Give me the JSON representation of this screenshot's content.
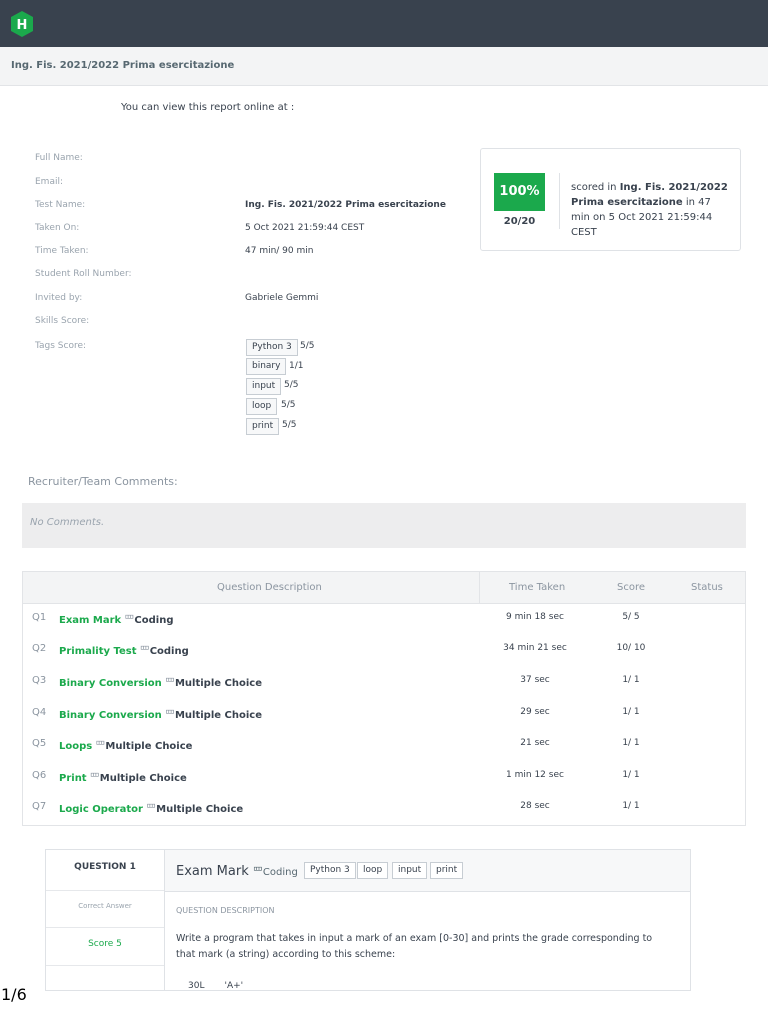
{
  "brand": {
    "logo_letter": "H",
    "logo_color": "#1ba94c",
    "topbar_color": "#39424e"
  },
  "subbar": {
    "title": "Ing. Fis. 2021/2022 Prima esercitazione"
  },
  "online_text": "You can view this report online at :",
  "info": {
    "full_name_label": "Full Name:",
    "email_label": "Email:",
    "test_name_label": "Test Name:",
    "test_name_value": "Ing. Fis. 2021/2022 Prima esercitazione",
    "taken_on_label": "Taken On:",
    "taken_on_value": "5 Oct 2021 21:59:44 CEST",
    "time_taken_label": "Time Taken:",
    "time_taken_value": "47 min/ 90 min",
    "roll_label": "Student Roll Number:",
    "invited_label": "Invited by:",
    "invited_value": "Gabriele Gemmi",
    "skills_label": "Skills Score:",
    "tags_label": "Tags Score:",
    "tags": [
      {
        "name": "Python 3",
        "score": "5/5"
      },
      {
        "name": "binary",
        "score": "1/1"
      },
      {
        "name": "input",
        "score": "5/5"
      },
      {
        "name": "loop",
        "score": "5/5"
      },
      {
        "name": "print",
        "score": "5/5"
      }
    ]
  },
  "scorecard": {
    "percent": "100%",
    "fraction": "20/20",
    "text_prefix": "scored in ",
    "test_name": "Ing. Fis. 2021/2022 Prima esercitazione",
    "text_mid": " in 47 min on 5 Oct 2021 21:59:44 CEST",
    "accent": "#1ba94c"
  },
  "comments": {
    "label": "Recruiter/Team Comments:",
    "empty_text": "No Comments."
  },
  "questions_table": {
    "headers": {
      "description": "Question Description",
      "time": "Time Taken",
      "score": "Score",
      "status": "Status"
    },
    "type_glyph": "罒",
    "rows": [
      {
        "num": "Q1",
        "name": "Exam Mark",
        "type": "Coding",
        "time": "9 min 18 sec",
        "score": "5/ 5"
      },
      {
        "num": "Q2",
        "name": "Primality Test",
        "type": "Coding",
        "time": "34 min 21 sec",
        "score": "10/ 10"
      },
      {
        "num": "Q3",
        "name": "Binary Conversion",
        "type": "Multiple Choice",
        "time": "37 sec",
        "score": "1/ 1"
      },
      {
        "num": "Q4",
        "name": "Binary Conversion",
        "type": "Multiple Choice",
        "time": "29 sec",
        "score": "1/ 1"
      },
      {
        "num": "Q5",
        "name": "Loops",
        "type": "Multiple Choice",
        "time": "21 sec",
        "score": "1/ 1"
      },
      {
        "num": "Q6",
        "name": "Print",
        "type": "Multiple Choice",
        "time": "1 min 12 sec",
        "score": "1/ 1"
      },
      {
        "num": "Q7",
        "name": "Logic Operator",
        "type": "Multiple Choice",
        "time": "28 sec",
        "score": "1/ 1"
      }
    ]
  },
  "question_card": {
    "label": "QUESTION 1",
    "correct_answer": "Correct Answer",
    "score": "Score 5",
    "title": "Exam Mark",
    "type_glyph": "罒",
    "type": "Coding",
    "tags": [
      "Python 3",
      "loop",
      "input",
      "print"
    ],
    "desc_label": "QUESTION DESCRIPTION",
    "description": "Write a program that takes in input a mark of an exam [0-30] and prints the grade corresponding to that mark (a string) according to this scheme:",
    "cut_line": "30L       'A+'"
  },
  "page_number": "1/6"
}
